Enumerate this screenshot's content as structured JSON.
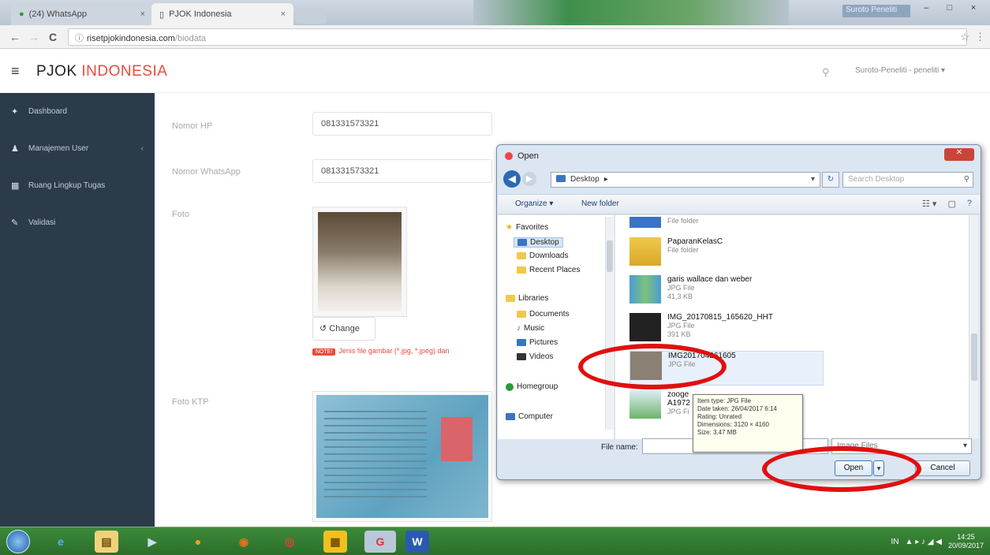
{
  "browser": {
    "tabs": [
      {
        "label": "(24) WhatsApp",
        "close": "×"
      },
      {
        "label": "PJOK Indonesia",
        "close": "×"
      }
    ],
    "window_controls": {
      "minimize": "–",
      "maximize": "□",
      "close": "×"
    },
    "window_user": "Suroto Peneliti",
    "url_host": "risetpjokindonesia.com",
    "url_path": "/biodata",
    "back": "←",
    "forward": "→",
    "reload": "C",
    "secure": "ⓘ",
    "star": "☆",
    "menu": "⋮"
  },
  "app": {
    "brand_part1": "PJOK",
    "brand_part2": "INDONESIA",
    "menu_icon": "≡",
    "search_icon": "⚲",
    "user_label": "Suroto-Peneliti - peneliti ▾"
  },
  "sidebar": {
    "items": [
      {
        "icon": "✦",
        "label": "Dashboard"
      },
      {
        "icon": "♟",
        "label": "Manajemen User",
        "arrow": "‹"
      },
      {
        "icon": "▦",
        "label": "Ruang Lingkup Tugas"
      },
      {
        "icon": "✎",
        "label": "Validasi"
      }
    ]
  },
  "form": {
    "hp_label": "Nomor HP",
    "hp_value": "081331573321",
    "wa_label": "Nomor WhatsApp",
    "wa_value": "081331573321",
    "foto_label": "Foto",
    "change_label": "Change",
    "change_icon": "↺",
    "note_badge": "NOTE!",
    "note_text": "Jenis file gambar (*.jpg, *.jpeg) dan",
    "ktp_label": "Foto KTP"
  },
  "dialog": {
    "title": "Open",
    "close": "✕",
    "back": "◀",
    "forward": "▶",
    "path": "Desktop",
    "path_sep": "▸",
    "path_dd": "▾",
    "refresh": "↻",
    "search_placeholder": "Search Desktop",
    "search_icon": "⚲",
    "organize": "Organize ▾",
    "new_folder": "New folder",
    "view_icons": [
      "☷ ▾",
      "▢",
      "?"
    ],
    "nav": {
      "favorites": "Favorites",
      "desktop": "Desktop",
      "downloads": "Downloads",
      "recent": "Recent Places",
      "libraries": "Libraries",
      "documents": "Documents",
      "music": "Music",
      "pictures": "Pictures",
      "videos": "Videos",
      "homegroup": "Homegroup",
      "computer": "Computer"
    },
    "files": [
      {
        "name": "",
        "type": "File folder",
        "size": ""
      },
      {
        "name": "PaparanKelasC",
        "type": "File folder",
        "size": ""
      },
      {
        "name": "garis wallace dan weber",
        "type": "JPG File",
        "size": "41,3 KB"
      },
      {
        "name": "IMG_20170815_165620_HHT",
        "type": "JPG File",
        "size": "391 KB"
      },
      {
        "name": "IMG201704261605",
        "type": "JPG File",
        "size": ""
      },
      {
        "name": "zooge A1972",
        "type": "JPG Fi",
        "size": ""
      }
    ],
    "tooltip": {
      "type": "Item type: JPG File",
      "date": "Date taken: 26/04/2017 6:14",
      "rating": "Rating: Unrated",
      "dimensions": "Dimensions: 3120 × 4160",
      "size": "Size: 3,47 MB"
    },
    "file_name_label": "File name:",
    "file_name_value": "",
    "filter": "Image Files",
    "filter_dd": "▾",
    "open": "Open",
    "open_split": "▾",
    "cancel": "Cancel"
  },
  "taskbar": {
    "apps": [
      "e",
      "▤",
      "▶",
      "●",
      "◉",
      "◎",
      "▦",
      "G",
      "W"
    ],
    "tray_lang": "IN",
    "tray_icons": "▲ ▸ ♪ ◢ ◀",
    "time": "14:25",
    "date": "20/09/2017"
  },
  "colors": {
    "accent_red": "#e74c3c",
    "sidebar": "#2c3b4a",
    "annotation": "#e01010"
  }
}
